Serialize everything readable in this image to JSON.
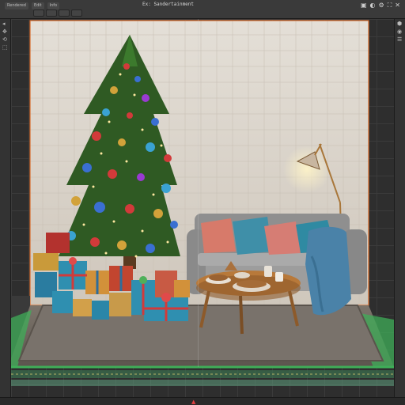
{
  "editor": {
    "title": "Ex: Sandertainment",
    "menu_items": [
      "Rendered",
      "Edit",
      "Info"
    ],
    "top_icons": [
      "▣",
      "◐",
      "⚙",
      "⛶",
      "✕"
    ],
    "left_tools": [
      "◂",
      "✥",
      "⟲",
      "⬚"
    ],
    "right_tools": [
      "⬢",
      "◉",
      "☰"
    ]
  },
  "scene": {
    "objects": [
      "christmas-tree",
      "gift-pile",
      "sofa",
      "cushions",
      "blanket",
      "floor-lamp",
      "coffee-table",
      "snack-plates",
      "mugs",
      "rug"
    ],
    "colors": {
      "wall": "#ddd7cf",
      "floor": "#6d655c",
      "rug": "#77706a",
      "tree": "#2f5a23",
      "sofa": "#9a9a9a",
      "table": "#b8793a",
      "selection_outline": "#d86a2a",
      "grid_edge": "#3fae58"
    }
  }
}
